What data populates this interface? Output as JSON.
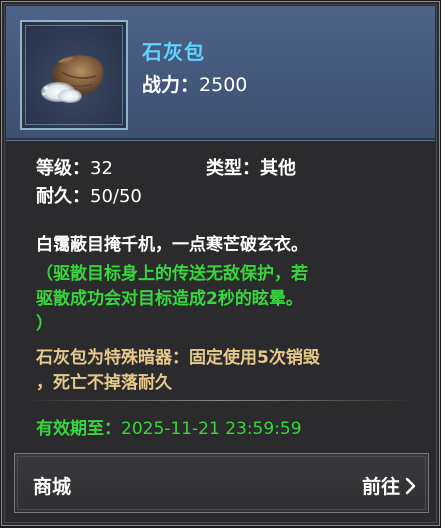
{
  "item": {
    "name": "石灰包",
    "power_label": "战力：",
    "power_value": "2500",
    "icon": "lime-powder-bag-icon"
  },
  "stats": {
    "level_label": "等级：",
    "level_value": "32",
    "type_label": "类型：",
    "type_value": "其他",
    "durability_label": "耐久：",
    "durability_value": "50/50"
  },
  "description": {
    "flavor": "白霭蔽目掩千机，一点寒芒破玄衣。",
    "effect_lines": [
      "（驱散目标身上的传送无敌保护，若",
      "驱散成功会对目标造成2秒的眩晕。",
      "）"
    ],
    "note_lines": [
      "石灰包为特殊暗器：固定使用5次销毁",
      "，死亡不掉落耐久"
    ]
  },
  "expiry": {
    "label": "有效期至：",
    "value": "2025-11-21 23:59:59"
  },
  "shop": {
    "label": "商城",
    "goto_label": "前往",
    "goto_icon": "chevron-right-icon"
  },
  "colors": {
    "name": "#5fd4ff",
    "effect": "#37d63c",
    "note": "#e6c98b",
    "header": "#4f6388"
  }
}
